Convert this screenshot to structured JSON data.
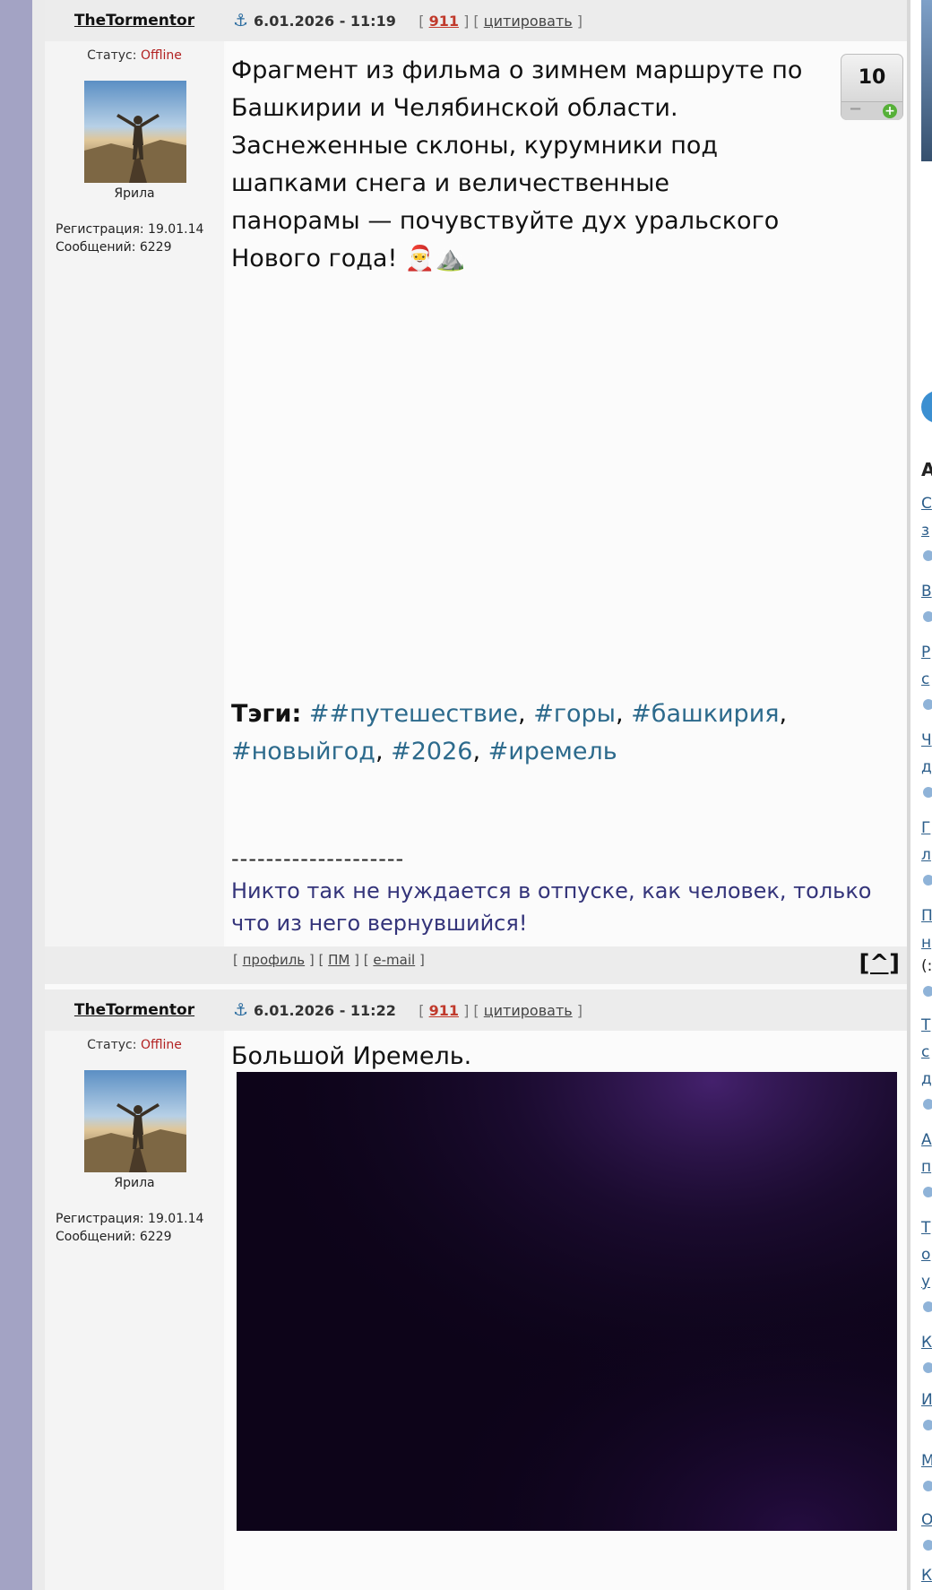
{
  "posts": [
    {
      "author": "TheTormentor",
      "date": "6.01.2026 - 11:19",
      "post_number": "911",
      "quote_label": "цитировать",
      "status_label": "Статус:",
      "status_value": "Offline",
      "rank": "Ярила",
      "registration": "Регистрация: 19.01.14",
      "messages": "Сообщений: 6229",
      "text": "Фрагмент из фильма о зимнем маршруте по Башкирии и Челябинской области. Заснеженные склоны, курумники под шапками снега и величественные панорамы — почувствуйте дух уральского Нового года! 🎅⛰️",
      "rating": "10",
      "tags_label": "Тэги:",
      "tags": [
        "##путешествие",
        "#горы",
        "#башкирия",
        "#новыйгод",
        "#2026",
        "#иремель"
      ],
      "signature_line": "--------------------",
      "signature_text": "Никто так не нуждается в отпуске, как человек, только что из него вернувшийся!",
      "footer": {
        "profile": "профиль",
        "pm": "ПМ",
        "email": "e-mail",
        "to_top": "[^]"
      }
    },
    {
      "author": "TheTormentor",
      "date": "6.01.2026 - 11:22",
      "post_number": "911",
      "quote_label": "цитировать",
      "status_label": "Статус:",
      "status_value": "Offline",
      "rank": "Ярила",
      "registration": "Регистрация: 19.01.14",
      "messages": "Сообщений: 6229",
      "text": "Большой Иремель."
    }
  ],
  "sidebar": {
    "heading": "А",
    "items": [
      "С",
      "з",
      "В",
      "Р",
      "с",
      "Ч",
      "д",
      "Г",
      "л",
      "П",
      "н",
      "(:",
      "Т",
      "с",
      "д",
      "А",
      "п",
      "Т",
      "о",
      "у",
      "К",
      "И",
      "М",
      "О",
      "К"
    ]
  }
}
